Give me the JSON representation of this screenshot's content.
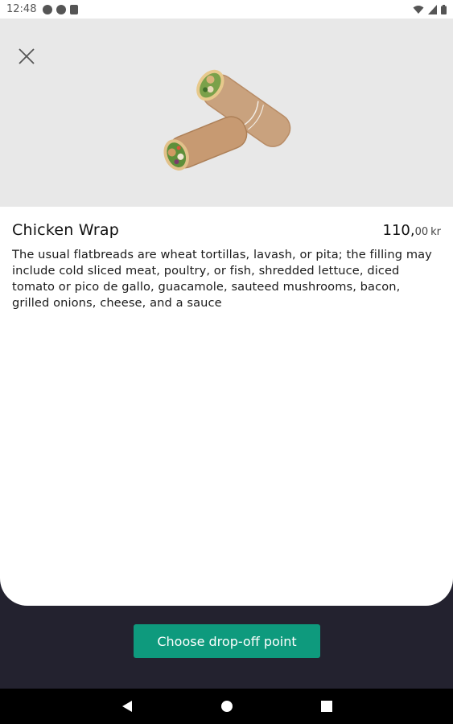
{
  "status_bar": {
    "time": "12:48",
    "icons": [
      "a-circle-icon",
      "g-circle-icon",
      "sim-card-icon"
    ],
    "right_icons": [
      "wifi-icon",
      "signal-icon",
      "battery-icon"
    ]
  },
  "product": {
    "image_icon": "chicken-wrap-image",
    "title": "Chicken Wrap",
    "price_whole": "110,",
    "price_decimal": "00",
    "price_currency": "kr",
    "description": "The usual flatbreads are wheat tortillas, lavash, or pita; the filling may include cold sliced meat, poultry, or fish, shredded lettuce, diced tomato or pico de gallo, guacamole, sauteed mushrooms, bacon, grilled onions, cheese, and a sauce"
  },
  "actions": {
    "cta_label": "Choose drop-off point"
  },
  "colors": {
    "accent": "#0e9a7d",
    "footer_bg": "#23222f",
    "hero_bg": "#e8e8e8"
  },
  "nav": [
    "back-icon",
    "home-icon",
    "recents-icon"
  ]
}
